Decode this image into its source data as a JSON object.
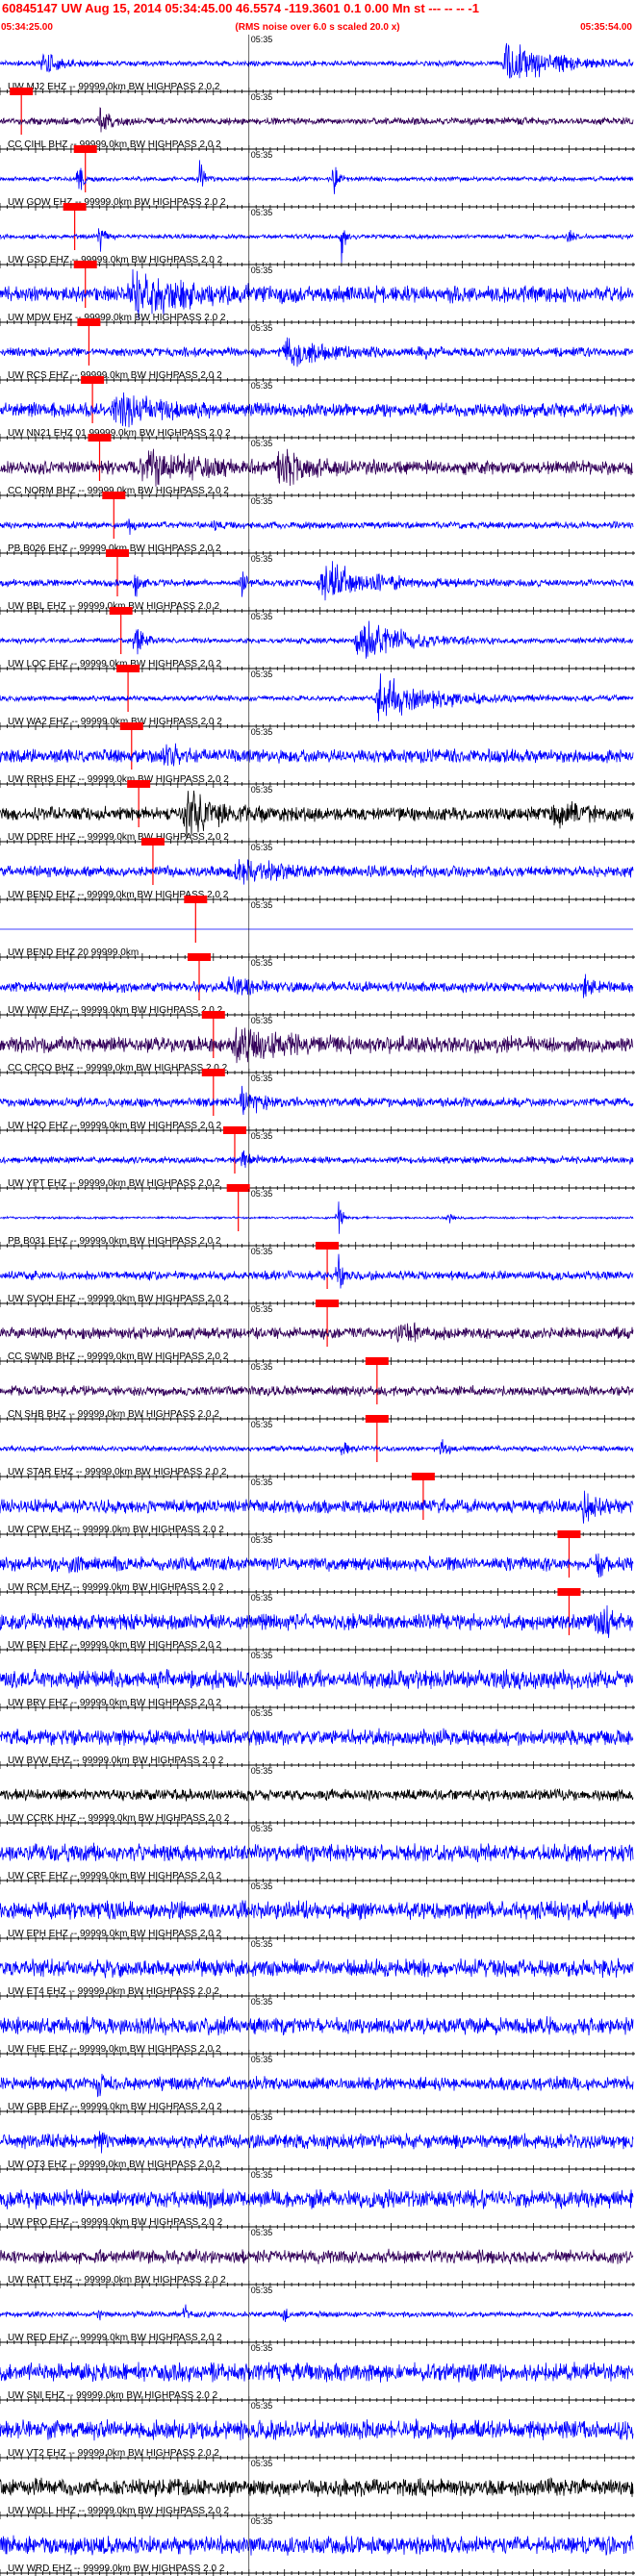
{
  "header": {
    "title": "60845147 UW Aug 15, 2014 05:34:45.00   46.5574 -119.3601  0.1 0.00 Mn st --- -- --  -1",
    "subtitle": "(RMS noise over 6.0 s scaled 20.0 x)",
    "start_time": "05:34:25.00",
    "end_time": "05:35:54.00"
  },
  "colors": {
    "title": "#ff0000",
    "trace_blue": "#0000ff",
    "trace_black": "#000000",
    "trace_purple": "#33005a",
    "pick": "#ff0000",
    "axis": "#000000"
  },
  "chart_data": {
    "type": "line",
    "title": "60845147 UW Aug 15, 2014 05:34:45.00   46.5574 -119.3601  0.1 0.00 Mn st --- -- --  -1",
    "subtitle": "(RMS noise over 6.0 s scaled 20.0 x)",
    "x_range": [
      "05:34:25.00",
      "05:35:54.00"
    ],
    "x_range_seconds": [
      0,
      89
    ],
    "minute_mark": "05:35",
    "minute_mark_seconds": 35,
    "tick_interval_seconds": 1,
    "grid": false,
    "series": [
      {
        "label": "UW MJ2 EHZ -- 99999.0km BW  HIGHPASS  2.0  2",
        "color": "blue",
        "pick_s": [
          3.0
        ],
        "events": [
          {
            "t": 6.0,
            "a": 0.5,
            "w": 2.0
          },
          {
            "t": 71.0,
            "a": 1.0,
            "w": 6.0
          }
        ],
        "noise": 0.12
      },
      {
        "label": "CC CIHL BHZ -- 99999.0km BW  HIGHPASS  2.0  2",
        "color": "purple",
        "pick_s": [
          12.0
        ],
        "events": [
          {
            "t": 14.0,
            "a": 0.6,
            "w": 1.5
          }
        ],
        "noise": 0.16
      },
      {
        "label": "UW GOW EHZ -- 99999.0km BW  HIGHPASS  2.0  2",
        "color": "blue",
        "pick_s": [
          10.5
        ],
        "events": [
          {
            "t": 11.0,
            "a": 1.0,
            "w": 0.5
          },
          {
            "t": 28.0,
            "a": 1.0,
            "w": 0.5
          },
          {
            "t": 47.0,
            "a": 0.9,
            "w": 0.5
          }
        ],
        "noise": 0.1
      },
      {
        "label": "UW GSD EHZ -- 99999.0km BW  HIGHPASS  2.0  2",
        "color": "blue",
        "pick_s": [
          12.0
        ],
        "events": [
          {
            "t": 14.0,
            "a": 0.9,
            "w": 0.6
          },
          {
            "t": 48.0,
            "a": 1.0,
            "w": 0.4
          },
          {
            "t": 80.0,
            "a": 1.0,
            "w": 0.4
          }
        ],
        "noise": 0.1
      },
      {
        "label": "UW MDW EHZ -- 99999.0km BW  HIGHPASS  2.0  2",
        "color": "blue",
        "pick_s": [
          12.5
        ],
        "events": [
          {
            "t": 18.0,
            "a": 0.8,
            "w": 8.0
          }
        ],
        "noise": 0.35
      },
      {
        "label": "UW RCS EHZ -- 99999.0km BW  HIGHPASS  2.0  2",
        "color": "blue",
        "pick_s": [
          13.0
        ],
        "events": [
          {
            "t": 40.0,
            "a": 0.6,
            "w": 5.0
          },
          {
            "t": 59.0,
            "a": 0.5,
            "w": 1.0
          }
        ],
        "noise": 0.2
      },
      {
        "label": "UW NN21 EHZ 01 99999.0km BW  HIGHPASS  2.0  2",
        "color": "blue",
        "pick_s": [
          14.0
        ],
        "events": [
          {
            "t": 16.0,
            "a": 0.6,
            "w": 6.0
          }
        ],
        "noise": 0.3
      },
      {
        "label": "CC NORM BHZ -- 99999.0km BW  HIGHPASS  2.0  2",
        "color": "purple",
        "pick_s": [
          16.0
        ],
        "events": [
          {
            "t": 20.0,
            "a": 0.7,
            "w": 6.0
          },
          {
            "t": 39.0,
            "a": 0.8,
            "w": 3.0
          }
        ],
        "noise": 0.3
      },
      {
        "label": "PB B026 EHZ -- 99999.0km BW  HIGHPASS  2.0  2",
        "color": "blue",
        "pick_s": [
          16.5
        ],
        "events": [
          {
            "t": 18.0,
            "a": 0.5,
            "w": 0.5
          },
          {
            "t": 30.0,
            "a": 0.4,
            "w": 0.5
          }
        ],
        "noise": 0.15
      },
      {
        "label": "UW BBL EHZ -- 99999.0km BW  HIGHPASS  2.0  2",
        "color": "blue",
        "pick_s": [
          17.0
        ],
        "events": [
          {
            "t": 19.0,
            "a": 0.7,
            "w": 0.5
          },
          {
            "t": 34.0,
            "a": 0.6,
            "w": 0.5
          },
          {
            "t": 45.0,
            "a": 1.0,
            "w": 6.0
          }
        ],
        "noise": 0.15
      },
      {
        "label": "UW LOC EHZ -- 99999.0km BW  HIGHPASS  2.0  2",
        "color": "blue",
        "pick_s": [
          18.0
        ],
        "events": [
          {
            "t": 19.0,
            "a": 0.8,
            "w": 1.0
          },
          {
            "t": 50.0,
            "a": 1.0,
            "w": 6.0
          }
        ],
        "noise": 0.12
      },
      {
        "label": "UW WA2 EHZ -- 99999.0km BW  HIGHPASS  2.0  2",
        "color": "blue",
        "pick_s": [
          18.5
        ],
        "events": [
          {
            "t": 53.0,
            "a": 1.0,
            "w": 7.0
          }
        ],
        "noise": 0.12
      },
      {
        "label": "UW RRHS EHZ -- 99999.0km BW  HIGHPASS  2.0  2",
        "color": "blue",
        "pick_s": [
          19.5
        ],
        "events": [
          {
            "t": 23.0,
            "a": 0.5,
            "w": 2.0
          }
        ],
        "noise": 0.3
      },
      {
        "label": "UW DDRF HHZ -- 99999.0km BW  HIGHPASS  2.0  2",
        "color": "black",
        "pick_s": [
          21.5
        ],
        "events": [
          {
            "t": 26.0,
            "a": 0.9,
            "w": 4.0
          },
          {
            "t": 78.0,
            "a": 0.7,
            "w": 3.0
          }
        ],
        "noise": 0.3
      },
      {
        "label": "UW BEND EHZ -- 99999.0km BW  HIGHPASS  2.0  2",
        "color": "blue",
        "pick_s": [
          27.5
        ],
        "events": [
          {
            "t": 33.0,
            "a": 0.5,
            "w": 5.0
          }
        ],
        "noise": 0.25
      },
      {
        "label": "UW BEND EHZ 20 99999.0km",
        "color": "blue",
        "pick_s": [
          28.0
        ],
        "events": [],
        "noise": 0.0
      },
      {
        "label": "UW WIW EHZ -- 99999.0km BW  HIGHPASS  2.0  2",
        "color": "blue",
        "pick_s": [
          30.0
        ],
        "events": [
          {
            "t": 32.0,
            "a": 0.4,
            "w": 3.0
          },
          {
            "t": 82.0,
            "a": 0.5,
            "w": 1.0
          }
        ],
        "noise": 0.22
      },
      {
        "label": "CC CPCO BHZ -- 99999.0km BW  HIGHPASS  2.0  2",
        "color": "purple",
        "pick_s": [
          30.0
        ],
        "events": [
          {
            "t": 33.0,
            "a": 0.8,
            "w": 6.0
          }
        ],
        "noise": 0.35
      },
      {
        "label": "UW H2O EHZ -- 99999.0km BW  HIGHPASS  2.0  2",
        "color": "blue",
        "pick_s": [
          33.0
        ],
        "events": [
          {
            "t": 34.0,
            "a": 0.8,
            "w": 2.0
          }
        ],
        "noise": 0.2
      },
      {
        "label": "UW YPT EHZ -- 99999.0km BW  HIGHPASS  2.0  2",
        "color": "blue",
        "pick_s": [
          33.5
        ],
        "events": [
          {
            "t": 34.0,
            "a": 0.6,
            "w": 1.0
          }
        ],
        "noise": 0.15
      },
      {
        "label": "PB B031 EHZ -- 99999.0km BW  HIGHPASS  2.0  2",
        "color": "blue",
        "pick_s": [
          46.0
        ],
        "events": [
          {
            "t": 47.5,
            "a": 1.0,
            "w": 0.5
          },
          {
            "t": 63.0,
            "a": 0.4,
            "w": 0.5
          }
        ],
        "noise": 0.05
      },
      {
        "label": "UW SVOH EHZ -- 99999.0km BW  HIGHPASS  2.0  2",
        "color": "blue",
        "pick_s": [
          46.0
        ],
        "events": [
          {
            "t": 47.5,
            "a": 1.0,
            "w": 0.6
          }
        ],
        "noise": 0.2
      },
      {
        "label": "CC SWNB BHZ -- 99999.0km BW  HIGHPASS  2.0  2",
        "color": "purple",
        "pick_s": [
          53.0
        ],
        "events": [
          {
            "t": 56.0,
            "a": 0.6,
            "w": 2.0
          }
        ],
        "noise": 0.25
      },
      {
        "label": "CN SHB BHZ -- 99999.0km BW  HIGHPASS  2.0  2",
        "color": "purple",
        "pick_s": [
          53.0
        ],
        "events": [],
        "noise": 0.22
      },
      {
        "label": "UW STAR EHZ -- 99999.0km BW  HIGHPASS  2.0  2",
        "color": "blue",
        "pick_s": [
          59.5
        ],
        "events": [
          {
            "t": 48.0,
            "a": 0.3,
            "w": 1.0
          },
          {
            "t": 62.0,
            "a": 0.5,
            "w": 1.0
          }
        ],
        "noise": 0.12
      },
      {
        "label": "UW CPW EHZ -- 99999.0km BW  HIGHPASS  2.0  2",
        "color": "blue",
        "pick_s": [
          80.0
        ],
        "events": [
          {
            "t": 82.0,
            "a": 0.8,
            "w": 1.5
          }
        ],
        "noise": 0.3
      },
      {
        "label": "UW RCM EHZ -- 99999.0km BW  HIGHPASS  2.0  2",
        "color": "blue",
        "pick_s": [
          80.0
        ],
        "events": [
          {
            "t": 10.0,
            "a": 0.8,
            "w": 0.5
          },
          {
            "t": 84.0,
            "a": 1.0,
            "w": 0.6
          }
        ],
        "noise": 0.3
      },
      {
        "label": "UW BEN EHZ -- 99999.0km BW  HIGHPASS  2.0  2",
        "color": "blue",
        "pick_s": [],
        "events": [
          {
            "t": 84.0,
            "a": 0.6,
            "w": 2.0
          }
        ],
        "noise": 0.35
      },
      {
        "label": "UW BRV EHZ -- 99999.0km BW  HIGHPASS  2.0  2",
        "color": "blue",
        "pick_s": [],
        "events": [],
        "noise": 0.42
      },
      {
        "label": "UW BVW EHZ -- 99999.0km BW  HIGHPASS  2.0  2",
        "color": "blue",
        "pick_s": [],
        "events": [],
        "noise": 0.35
      },
      {
        "label": "UW CCRK HHZ -- 99999.0km BW  HIGHPASS  2.0  2",
        "color": "black",
        "pick_s": [],
        "events": [],
        "noise": 0.25
      },
      {
        "label": "UW CRF EHZ -- 99999.0km BW  HIGHPASS  2.0  2",
        "color": "blue",
        "pick_s": [],
        "events": [],
        "noise": 0.38
      },
      {
        "label": "UW EPH EHZ -- 99999.0km BW  HIGHPASS  2.0  2",
        "color": "blue",
        "pick_s": [],
        "events": [],
        "noise": 0.4
      },
      {
        "label": "UW ET4 EHZ -- 99999.0km BW  HIGHPASS  2.0  2",
        "color": "blue",
        "pick_s": [],
        "events": [],
        "noise": 0.38
      },
      {
        "label": "UW FHE EHZ -- 99999.0km BW  HIGHPASS  2.0  2",
        "color": "blue",
        "pick_s": [],
        "events": [],
        "noise": 0.38
      },
      {
        "label": "UW GBB EHZ -- 99999.0km BW  HIGHPASS  2.0  2",
        "color": "blue",
        "pick_s": [],
        "events": [
          {
            "t": 14.0,
            "a": 0.8,
            "w": 0.4
          }
        ],
        "noise": 0.3
      },
      {
        "label": "UW OT3 EHZ -- 99999.0km BW  HIGHPASS  2.0  2",
        "color": "blue",
        "pick_s": [],
        "events": [
          {
            "t": 14.0,
            "a": 0.8,
            "w": 0.4
          }
        ],
        "noise": 0.32
      },
      {
        "label": "UW PRO EHZ -- 99999.0km BW  HIGHPASS  2.0  2",
        "color": "blue",
        "pick_s": [],
        "events": [],
        "noise": 0.4
      },
      {
        "label": "UW RATT EHZ -- 99999.0km BW  HIGHPASS  2.0  2",
        "color": "purple",
        "pick_s": [],
        "events": [],
        "noise": 0.3
      },
      {
        "label": "UW RED EHZ -- 99999.0km BW  HIGHPASS  2.0  2",
        "color": "blue",
        "pick_s": [],
        "events": [
          {
            "t": 14.0,
            "a": 0.5,
            "w": 0.4
          },
          {
            "t": 26.0,
            "a": 0.6,
            "w": 0.4
          },
          {
            "t": 40.0,
            "a": 0.4,
            "w": 0.4
          }
        ],
        "noise": 0.12
      },
      {
        "label": "UW SNI EHZ -- 99999.0km BW  HIGHPASS  2.0  2",
        "color": "blue",
        "pick_s": [],
        "events": [],
        "noise": 0.4
      },
      {
        "label": "UW VT2 EHZ -- 99999.0km BW  HIGHPASS  2.0  2",
        "color": "blue",
        "pick_s": [],
        "events": [],
        "noise": 0.42
      },
      {
        "label": "UW WOLL HHZ -- 99999.0km BW  HIGHPASS  2.0  2",
        "color": "black",
        "pick_s": [],
        "events": [],
        "noise": 0.38
      },
      {
        "label": "UW WRD EHZ -- 99999.0km BW  HIGHPASS  2.0  2",
        "color": "blue",
        "pick_s": [],
        "events": [],
        "noise": 0.4
      }
    ]
  }
}
